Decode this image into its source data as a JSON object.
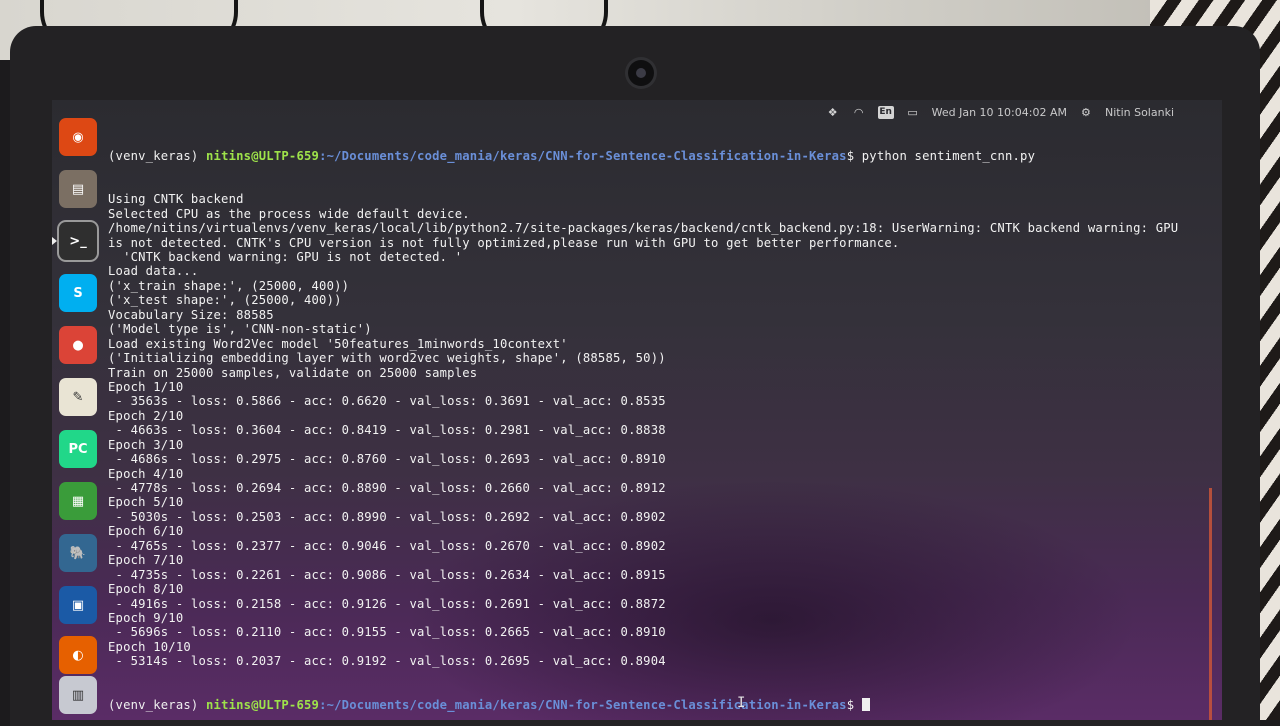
{
  "panel": {
    "datetime": "Wed Jan 10 10:04:02 AM",
    "username": "Nitin Solanki",
    "keyboard_layout": "En",
    "icons": [
      "dropbox-icon",
      "wifi-icon",
      "keyboard-layout-icon",
      "battery-icon",
      "power-gear-icon"
    ]
  },
  "launcher": {
    "items": [
      {
        "name": "ubuntu-dash",
        "icon": "ubuntu-logo-icon",
        "color": "#dd4814",
        "glyph": "◉"
      },
      {
        "name": "file-cabinet",
        "icon": "files-icon",
        "color": "#7b6f63",
        "glyph": "▤"
      },
      {
        "name": "terminal",
        "icon": "terminal-icon",
        "color": "#2f2f2f",
        "glyph": ">_"
      },
      {
        "name": "skype",
        "icon": "skype-icon",
        "color": "#00aff0",
        "glyph": "S"
      },
      {
        "name": "chrome",
        "icon": "chrome-icon",
        "color": "#db4437",
        "glyph": "●"
      },
      {
        "name": "text-editor",
        "icon": "text-editor-icon",
        "color": "#e9e4d4",
        "glyph": "✎"
      },
      {
        "name": "pycharm",
        "icon": "pycharm-icon",
        "color": "#21d789",
        "glyph": "PC"
      },
      {
        "name": "spreadsheet",
        "icon": "libreoffice-calc-icon",
        "color": "#3a9c3a",
        "glyph": "▦"
      },
      {
        "name": "postgres",
        "icon": "pgadmin-elephant-icon",
        "color": "#336791",
        "glyph": "🐘"
      },
      {
        "name": "virtualbox",
        "icon": "virtualbox-icon",
        "color": "#1b5aa6",
        "glyph": "▣"
      },
      {
        "name": "firefox",
        "icon": "firefox-icon",
        "color": "#e66000",
        "glyph": "◐"
      },
      {
        "name": "document",
        "icon": "document-viewer-icon",
        "color": "#c7c9d1",
        "glyph": "▥"
      }
    ]
  },
  "terminal": {
    "prompt_env": "(venv_keras) ",
    "prompt_user": "nitins@ULTP-659",
    "prompt_path": ":~/Documents/code_mania/keras/CNN-for-Sentence-Classification-in-Keras",
    "prompt_symbol": "$ ",
    "command": "python sentiment_cnn.py",
    "output": [
      "Using CNTK backend",
      "Selected CPU as the process wide default device.",
      "/home/nitins/virtualenvs/venv_keras/local/lib/python2.7/site-packages/keras/backend/cntk_backend.py:18: UserWarning: CNTK backend warning: GPU",
      "is not detected. CNTK's CPU version is not fully optimized,please run with GPU to get better performance.",
      "  'CNTK backend warning: GPU is not detected. '",
      "Load data...",
      "('x_train shape:', (25000, 400))",
      "('x_test shape:', (25000, 400))",
      "Vocabulary Size: 88585",
      "('Model type is', 'CNN-non-static')",
      "Load existing Word2Vec model '50features_1minwords_10context'",
      "('Initializing embedding layer with word2vec weights, shape', (88585, 50))",
      "Train on 25000 samples, validate on 25000 samples",
      "Epoch 1/10",
      " - 3563s - loss: 0.5866 - acc: 0.6620 - val_loss: 0.3691 - val_acc: 0.8535",
      "Epoch 2/10",
      " - 4663s - loss: 0.3604 - acc: 0.8419 - val_loss: 0.2981 - val_acc: 0.8838",
      "Epoch 3/10",
      " - 4686s - loss: 0.2975 - acc: 0.8760 - val_loss: 0.2693 - val_acc: 0.8910",
      "Epoch 4/10",
      " - 4778s - loss: 0.2694 - acc: 0.8890 - val_loss: 0.2660 - val_acc: 0.8912",
      "Epoch 5/10",
      " - 5030s - loss: 0.2503 - acc: 0.8990 - val_loss: 0.2692 - val_acc: 0.8902",
      "Epoch 6/10",
      " - 4765s - loss: 0.2377 - acc: 0.9046 - val_loss: 0.2670 - val_acc: 0.8902",
      "Epoch 7/10",
      " - 4735s - loss: 0.2261 - acc: 0.9086 - val_loss: 0.2634 - val_acc: 0.8915",
      "Epoch 8/10",
      " - 4916s - loss: 0.2158 - acc: 0.9126 - val_loss: 0.2691 - val_acc: 0.8872",
      "Epoch 9/10",
      " - 5696s - loss: 0.2110 - acc: 0.9155 - val_loss: 0.2665 - val_acc: 0.8910",
      "Epoch 10/10",
      " - 5314s - loss: 0.2037 - acc: 0.9192 - val_loss: 0.2695 - val_acc: 0.8904"
    ]
  },
  "colors": {
    "prompt_user": "#9ee34a",
    "prompt_path": "#6a8fd8",
    "text": "#f2f2f2",
    "desktop_gradient_bottom": "#5a2c66"
  }
}
